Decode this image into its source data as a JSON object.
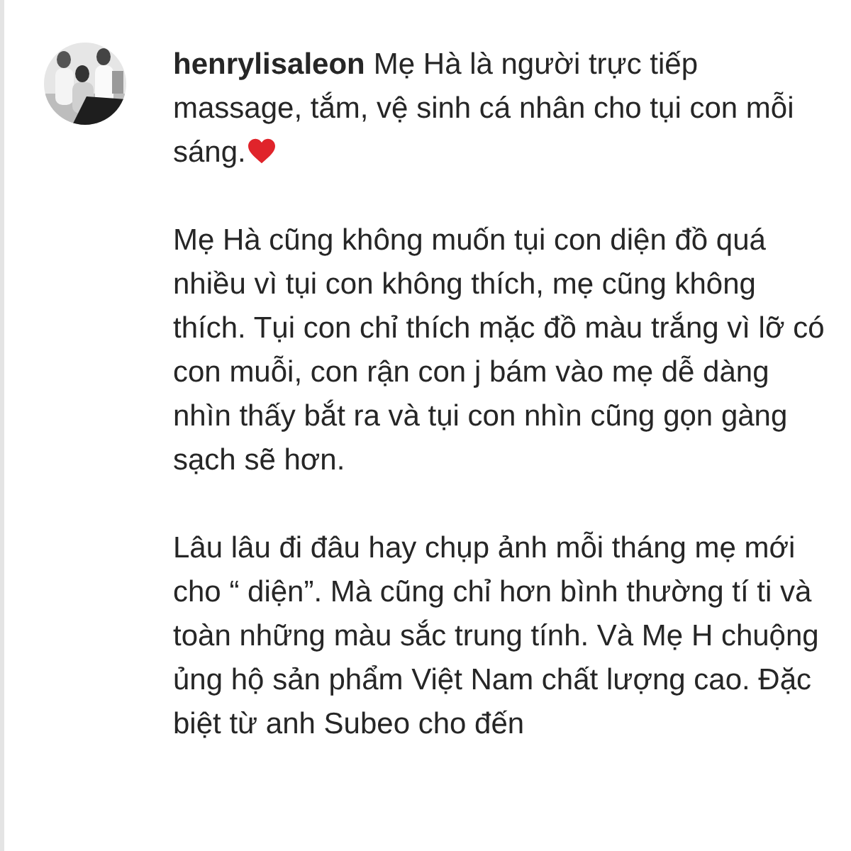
{
  "comment": {
    "username": "henrylisaleon",
    "paragraphs": [
      "Mẹ Hà là người trực tiếp massage, tắm, vệ sinh cá nhân cho tụi con mỗi sáng.",
      "Mẹ Hà cũng không muốn tụi con diện đồ quá nhiều vì tụi con không thích, mẹ cũng không thích. Tụi con chỉ thích mặc đồ màu trắng vì lỡ có con muỗi, con rận con j bám vào mẹ dễ dàng nhìn thấy bắt ra và tụi con nhìn cũng gọn gàng sạch sẽ hơn.",
      "Lâu lâu đi đâu hay chụp ảnh mỗi tháng mẹ mới cho “ diện”. Mà cũng chỉ hơn bình thường tí ti và toàn những màu sắc trung tính. Và Mẹ H chuộng ủng hộ sản phẩm Việt Nam chất lượng cao. Đặc biệt từ anh Subeo cho đến"
    ]
  }
}
